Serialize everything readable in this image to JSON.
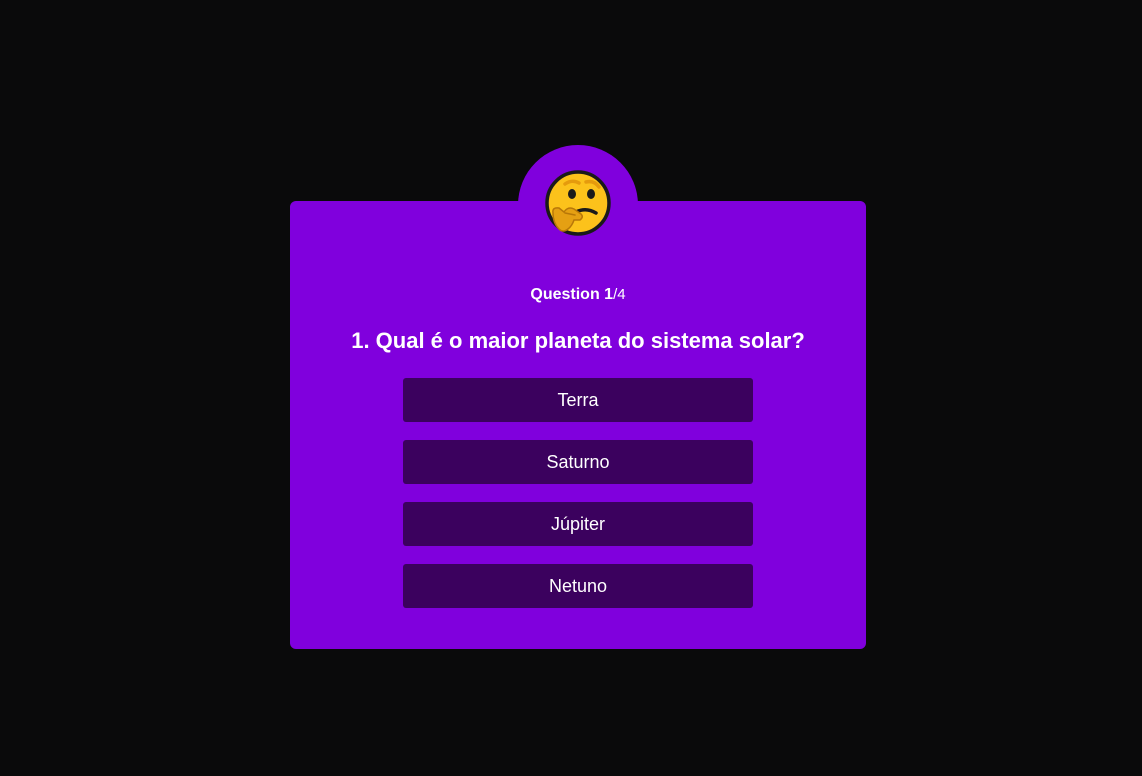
{
  "quiz": {
    "counter_prefix": "Question 1",
    "counter_total": "/4",
    "question": "1. Qual é o maior planeta do sistema solar?",
    "answers": [
      {
        "label": "Terra"
      },
      {
        "label": "Saturno"
      },
      {
        "label": "Júpiter"
      },
      {
        "label": "Netuno"
      }
    ],
    "emoji_icon": "thinking-face-icon"
  },
  "colors": {
    "page_background": "#0a0a0b",
    "card_background": "#8000dd",
    "answer_background": "#3b015e",
    "text": "#ffffff",
    "emoji_face": "#fcc21b",
    "emoji_hand": "#e5a013",
    "emoji_outline": "#1a1a1a"
  }
}
